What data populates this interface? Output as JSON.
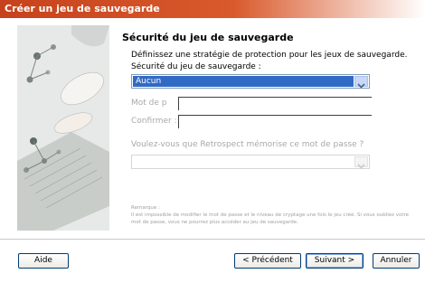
{
  "window": {
    "title": "Créer un jeu de sauvegarde"
  },
  "section": {
    "heading": "Sécurité du jeu de sauvegarde",
    "description": "Définissez une stratégie de protection pour les jeux de sauvegarde."
  },
  "security": {
    "label": "Sécurité du jeu de sauvegarde :",
    "selected": "Aucun"
  },
  "password": {
    "label": "Mot de p"
  },
  "confirm": {
    "label": "Confirmer :"
  },
  "remember": {
    "question": "Voulez-vous que Retrospect mémorise ce mot de passe ?",
    "selected": ""
  },
  "remark": {
    "title": "Remarque :",
    "text": "Il est impossible de modifier le mot de passe et le niveau de cryptage une fois le jeu créé. Si vous oubliez votre mot de passe, vous ne pourrez plus accéder au jeu de sauvegarde."
  },
  "buttons": {
    "help": "Aide",
    "previous": "< Précédent",
    "next": "Suivant >",
    "cancel": "Annuler"
  },
  "colors": {
    "titlebar": "#c6421c",
    "selection": "#316ac5"
  }
}
